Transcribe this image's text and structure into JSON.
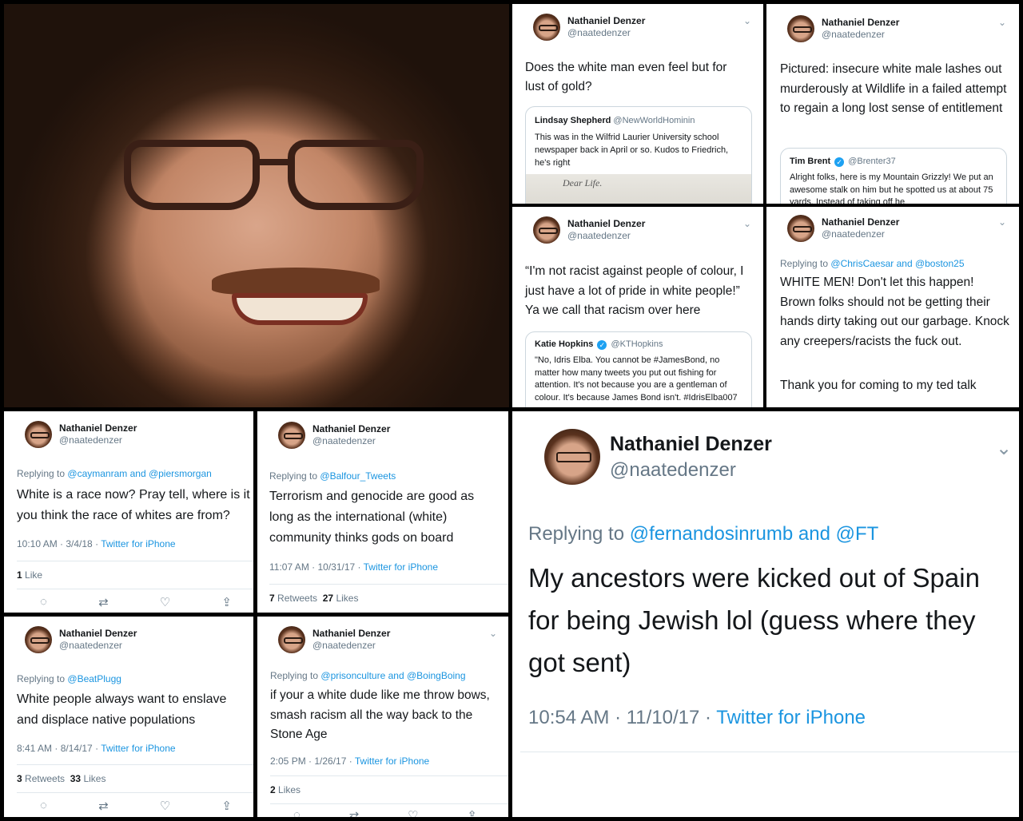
{
  "author": {
    "name": "Nathaniel Denzer",
    "handle": "@naatedenzer"
  },
  "icons": {
    "menu": "chevron-down-icon",
    "reply": "reply-icon",
    "retweet": "retweet-icon",
    "like": "heart-icon",
    "share": "share-icon",
    "verified": "verified-badge-icon"
  },
  "colors": {
    "link": "#1b95e0",
    "muted": "#657786",
    "text": "#14171a",
    "verified": "#1da1f2"
  },
  "tweets": [
    {
      "text": "Does the white man even feel but for lust of gold?",
      "quote": {
        "name": "Lindsay Shepherd",
        "handle": "@NewWorldHominin",
        "text": "This was in the Wilfrid Laurier University school newspaper back in April or so. Kudos to Friedrich, he's right",
        "image_text": "Dear Life."
      }
    },
    {
      "text": "Pictured: insecure white male lashes out murderously at Wildlife in a failed attempt to regain a long lost sense of entitlement",
      "quote": {
        "name": "Tim Brent",
        "handle": "@Brenter37",
        "text": "Alright folks, here is my Mountain Grizzly! We put an awesome stalk on him but he spotted us at about 75 yards. Instead of taking off he"
      }
    },
    {
      "text": "“I'm not racist against people of colour, I just have a lot of pride in white people!” Ya we call that racism over here",
      "quote": {
        "name": "Katie Hopkins",
        "handle": "@KTHopkins",
        "text": "\"No, Idris Elba. You cannot be #JamesBond, no matter how many tweets you put out fishing for attention. It's not because you are a gentleman of colour. It's because James Bond isn't. #IdrisElba007"
      }
    },
    {
      "replying_label": "Replying to",
      "replying_to": "@ChrisCaesar and @boston25",
      "text": "WHITE MEN! Don't let this happen! Brown folks should not be getting their hands dirty taking out our garbage. Knock any creepers/racists the fuck out.",
      "text2": "Thank you for coming to my ted talk"
    },
    {
      "replying_label": "Replying to",
      "replying_to": "@caymanram and @piersmorgan",
      "text": "White is a race now? Pray tell, where is it you think the race of whites are from?",
      "time": "10:10 AM · 3/4/18 ·",
      "source": "Twitter for iPhone",
      "likes_count": "1",
      "likes_label": "Like"
    },
    {
      "replying_label": "Replying to",
      "replying_to": "@Balfour_Tweets",
      "text": "Terrorism and genocide are good as long as the international (white) community thinks gods on board",
      "time": "11:07 AM · 10/31/17 ·",
      "source": "Twitter for iPhone",
      "retweets_count": "7",
      "retweets_label": "Retweets",
      "likes_count": "27",
      "likes_label": "Likes"
    },
    {
      "replying_label": "Replying to",
      "replying_to": "@fernandosinrumb and @FT",
      "text": "My ancestors were kicked out of Spain for being Jewish lol (guess where they got sent)",
      "time": "10:54 AM · 11/10/17 ·",
      "source": "Twitter for iPhone"
    },
    {
      "replying_label": "Replying to",
      "replying_to": "@BeatPlugg",
      "text": "White people always want to enslave and displace native populations",
      "time": "8:41 AM · 8/14/17 ·",
      "source": "Twitter for iPhone",
      "retweets_count": "3",
      "retweets_label": "Retweets",
      "likes_count": "33",
      "likes_label": "Likes"
    },
    {
      "replying_label": "Replying to",
      "replying_to": "@prisonculture and @BoingBoing",
      "text": "if your a white dude like me throw bows, smash racism all the way back to the Stone Age",
      "time": "2:05 PM · 1/26/17 ·",
      "source": "Twitter for iPhone",
      "likes_count": "2",
      "likes_label": "Likes"
    }
  ]
}
